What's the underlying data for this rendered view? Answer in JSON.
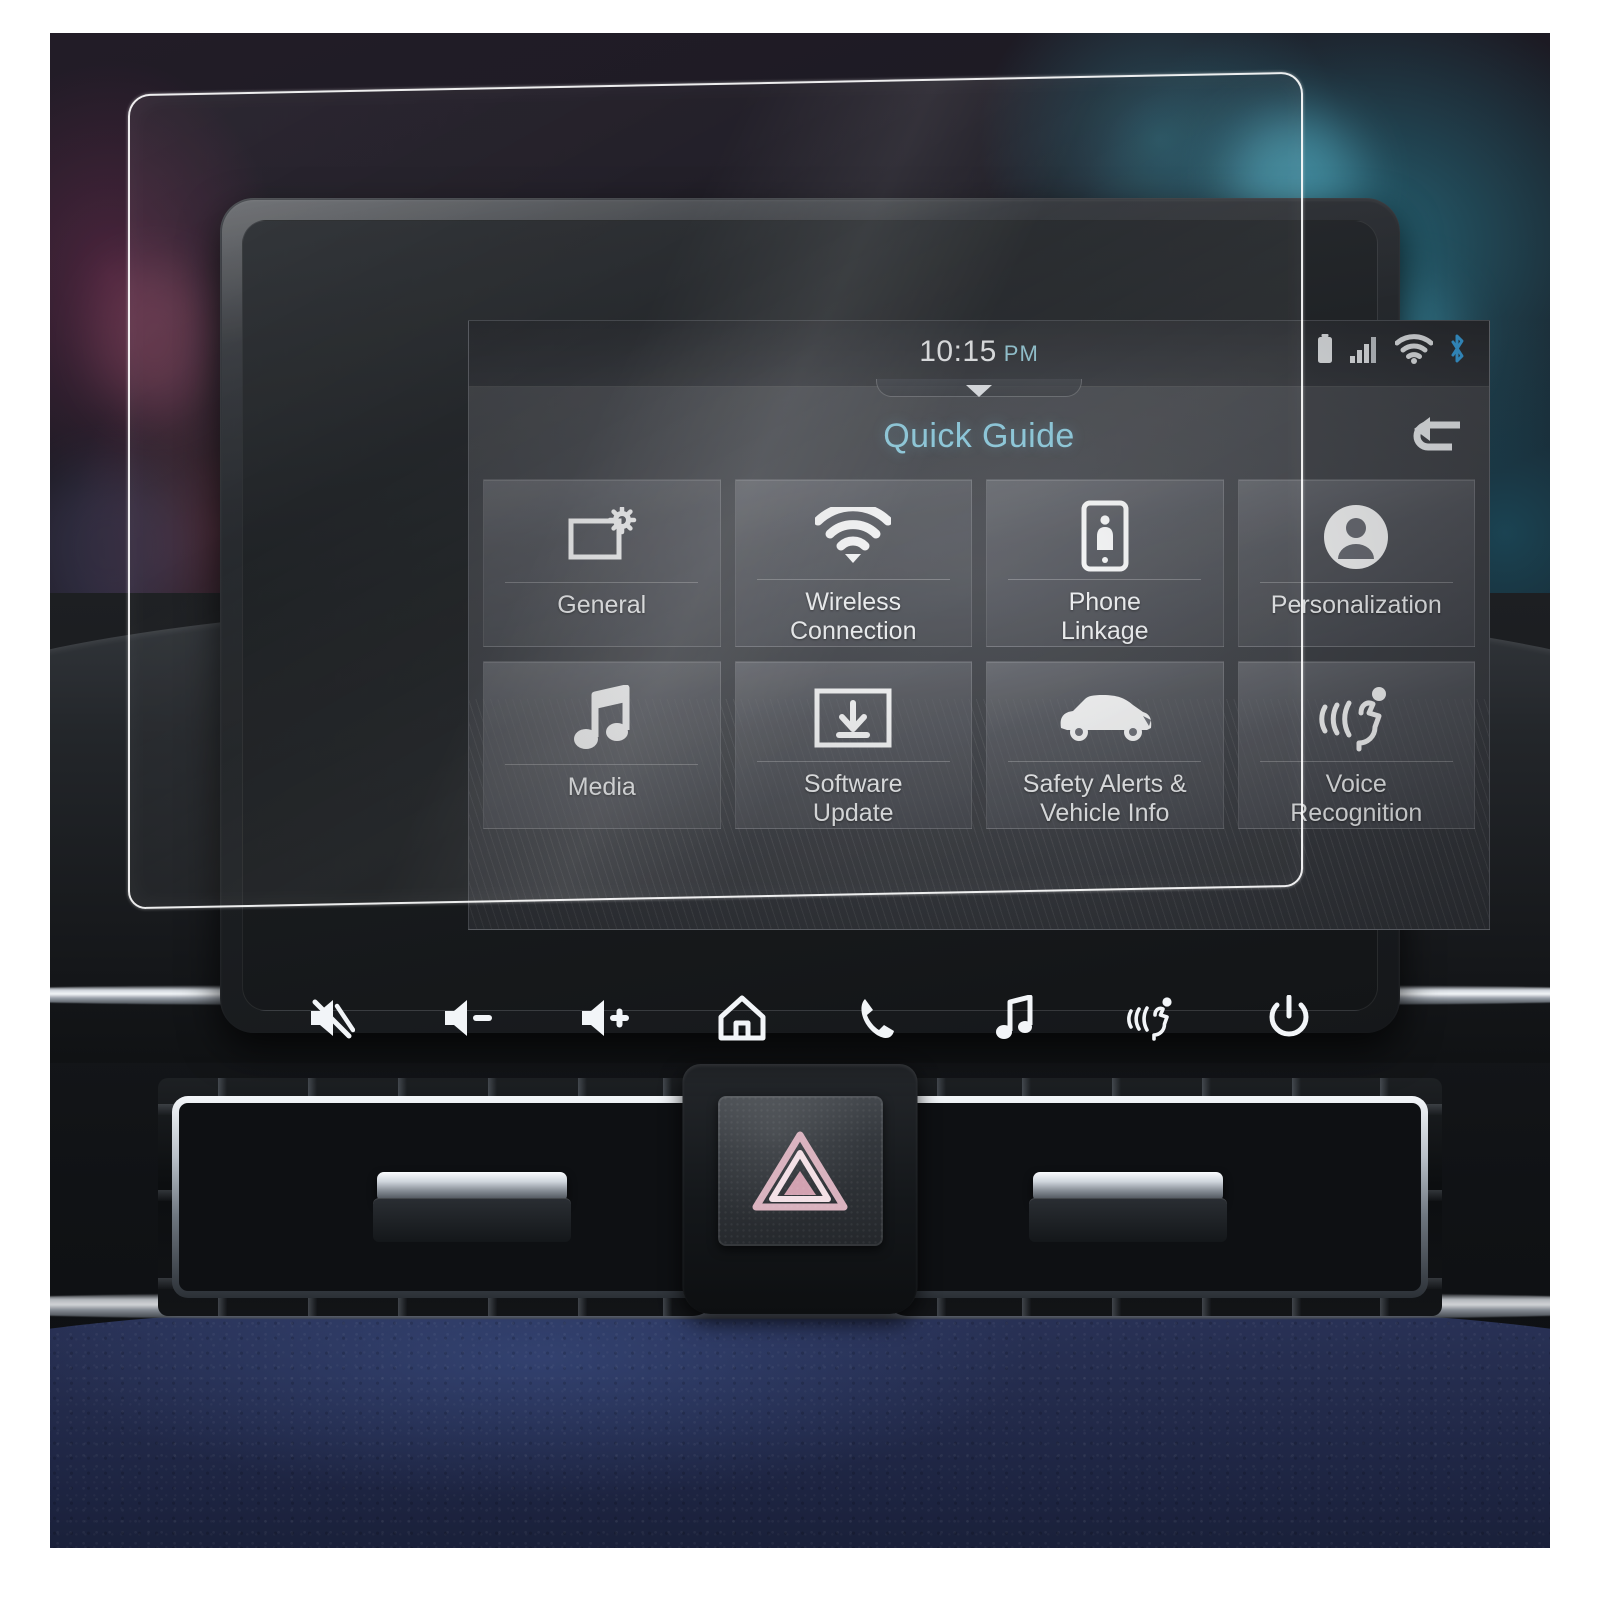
{
  "scene": {
    "description": "Car infotainment head unit with tempered glass screen protector overlay",
    "background_accent": "#2a7a8c",
    "dash_leather_color": "#242c4d"
  },
  "screen": {
    "status_bar": {
      "time": "10:15",
      "ampm": "PM",
      "icons": [
        {
          "name": "battery-icon",
          "color": "#f0f2f5"
        },
        {
          "name": "cellular-signal-icon",
          "color": "#f0f2f5"
        },
        {
          "name": "wifi-icon",
          "color": "#f0f2f5"
        },
        {
          "name": "bluetooth-icon",
          "color": "#3ba7e8"
        }
      ]
    },
    "title": "Quick Guide",
    "title_color": "#8fd2e6",
    "back_button": {
      "name": "back-arrow-icon",
      "label": "Back"
    },
    "tiles": [
      {
        "label": "General",
        "icon": "display-settings-icon"
      },
      {
        "label": "Wireless\nConnection",
        "icon": "wifi-icon"
      },
      {
        "label": "Phone\nLinkage",
        "icon": "phone-person-icon"
      },
      {
        "label": "Personalization",
        "icon": "user-avatar-icon"
      },
      {
        "label": "Media",
        "icon": "music-note-icon"
      },
      {
        "label": "Software\nUpdate",
        "icon": "download-box-icon"
      },
      {
        "label": "Safety Alerts &\nVehicle Info",
        "icon": "car-icon"
      },
      {
        "label": "Voice\nRecognition",
        "icon": "voice-recognition-icon"
      }
    ]
  },
  "hard_keys": [
    {
      "name": "mute-button",
      "icon": "speaker-mute-icon"
    },
    {
      "name": "volume-down-button",
      "icon": "speaker-minus-icon"
    },
    {
      "name": "volume-up-button",
      "icon": "speaker-plus-icon"
    },
    {
      "name": "home-button",
      "icon": "home-icon"
    },
    {
      "name": "phone-button",
      "icon": "phone-handset-icon"
    },
    {
      "name": "media-button",
      "icon": "music-note-icon"
    },
    {
      "name": "voice-button",
      "icon": "voice-recognition-icon"
    },
    {
      "name": "power-button",
      "icon": "power-icon"
    }
  ],
  "dashboard": {
    "hazard_button": {
      "name": "hazard-lights-button",
      "icon": "warning-triangle-icon",
      "color": "#d9a8b4"
    },
    "vents": [
      {
        "name": "air-vent-left"
      },
      {
        "name": "air-vent-right"
      }
    ]
  }
}
